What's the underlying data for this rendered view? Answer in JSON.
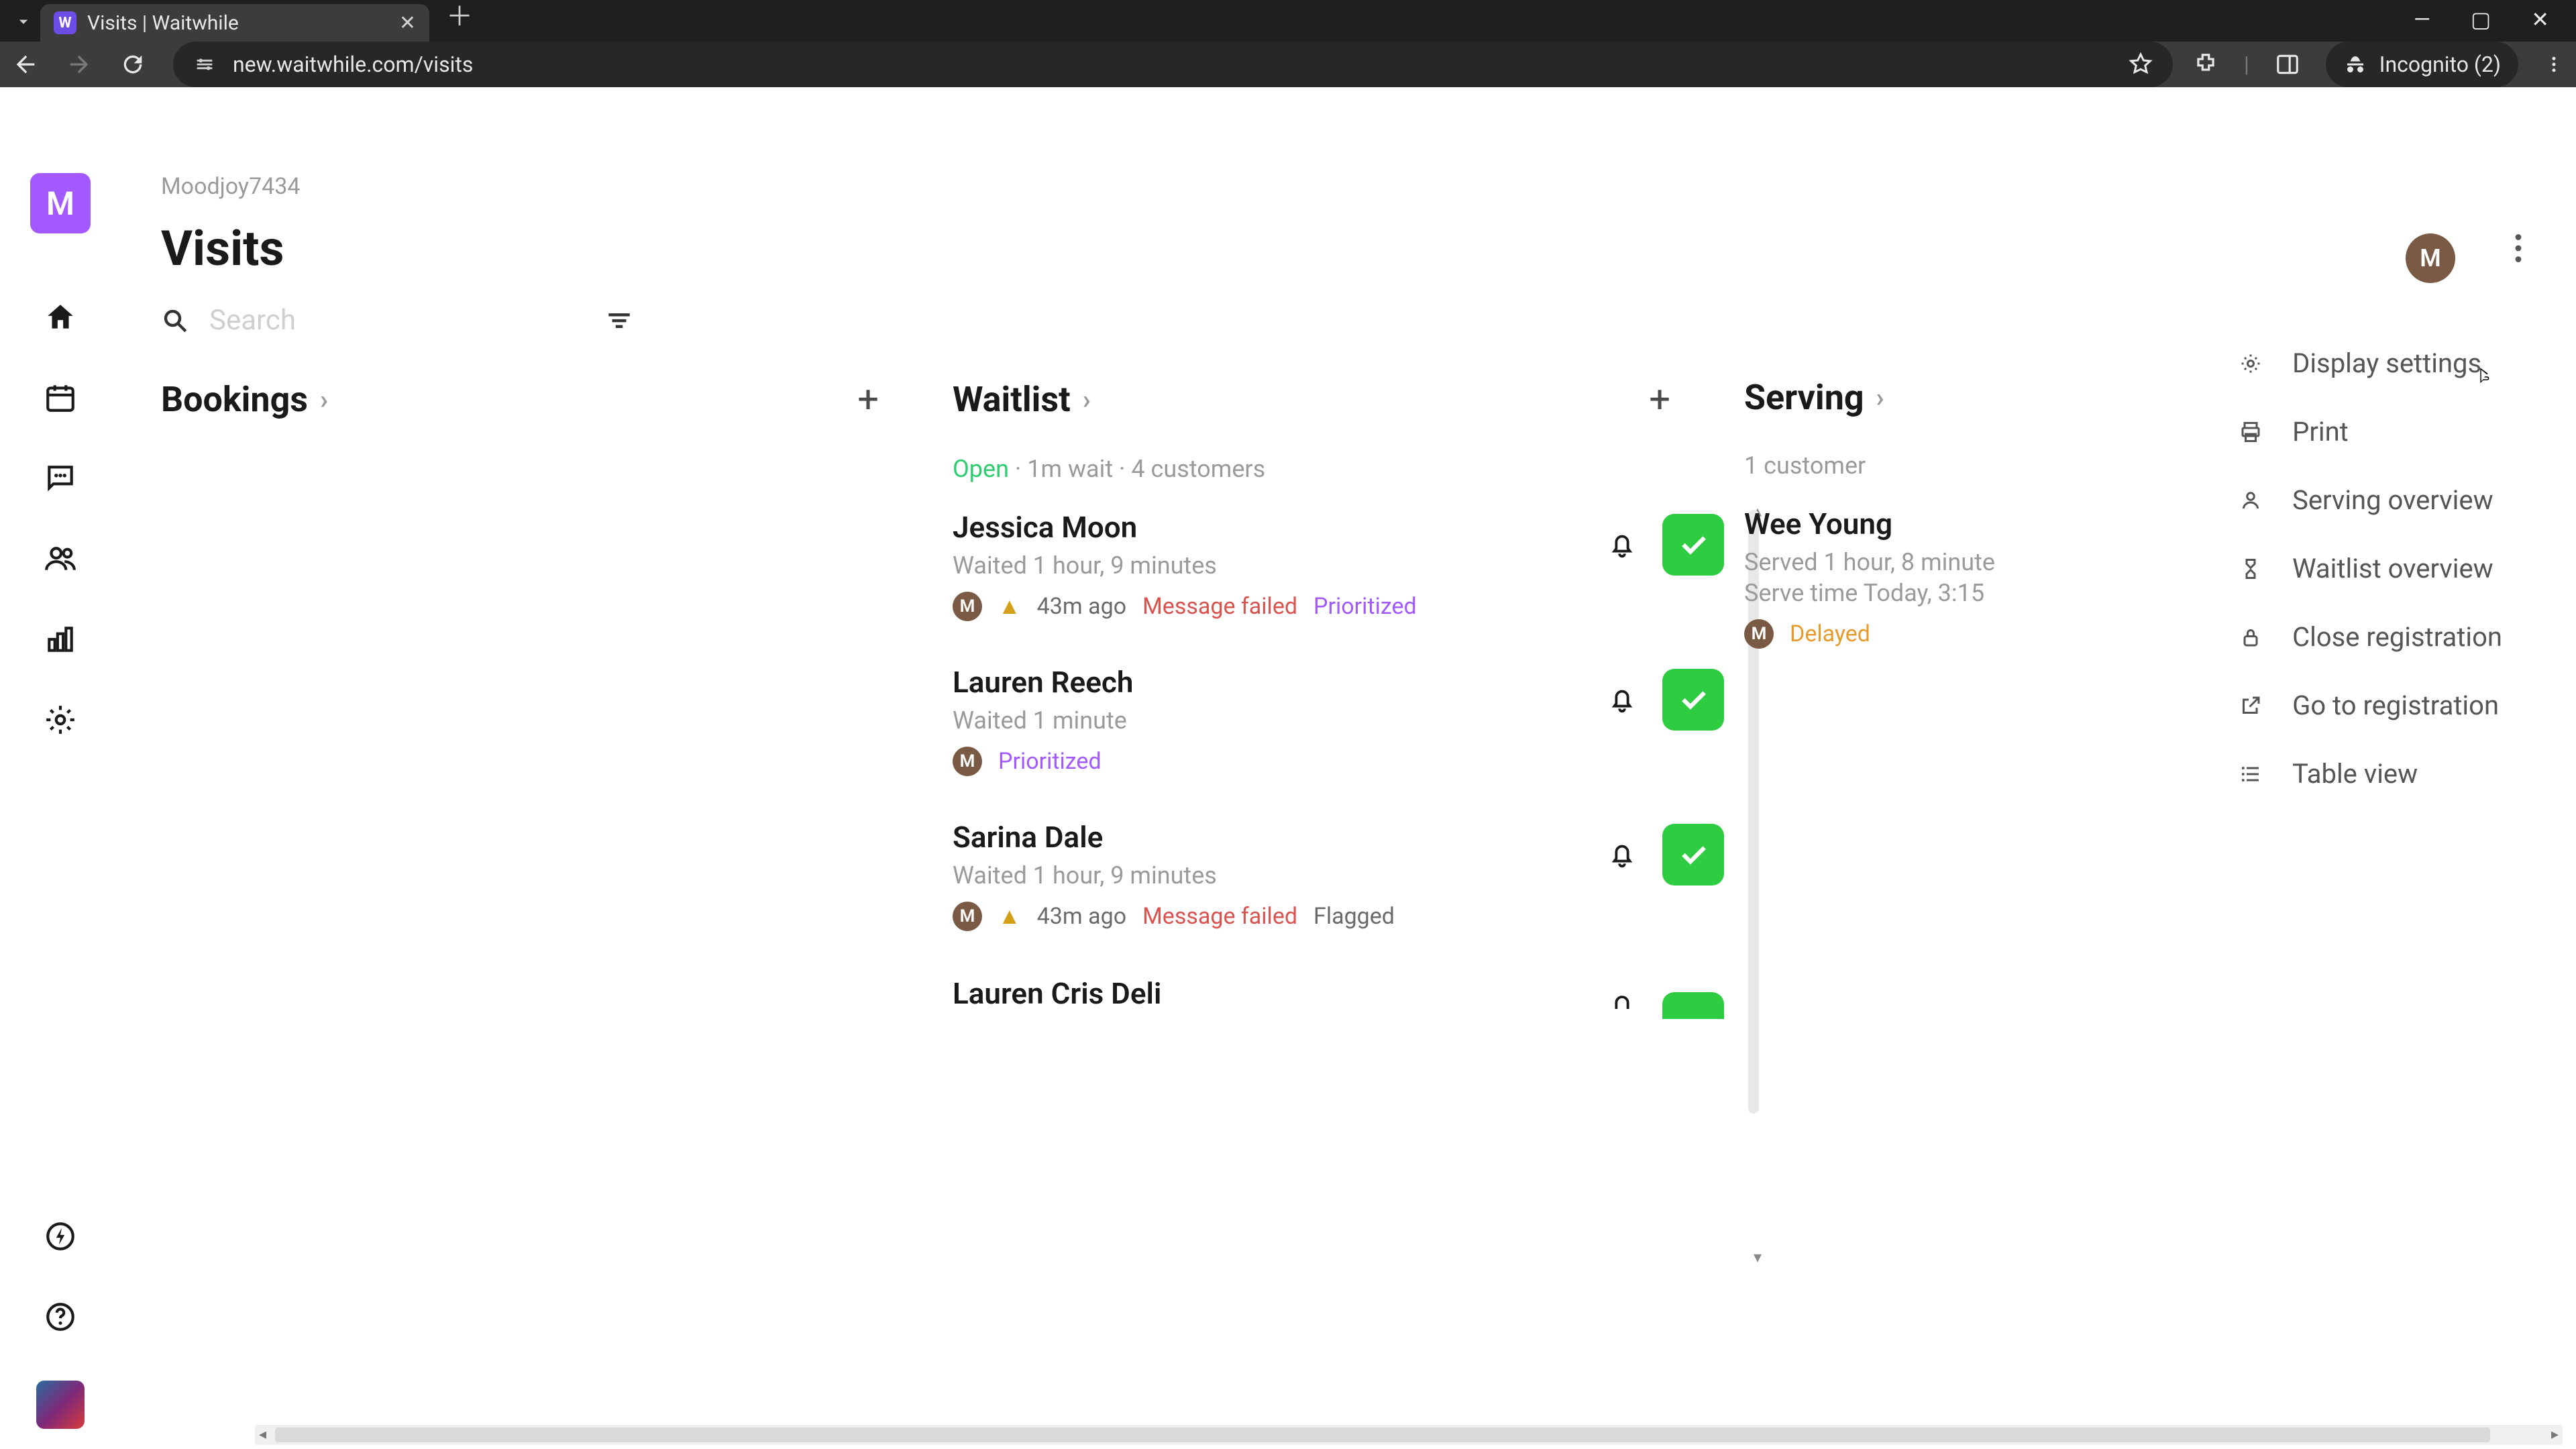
{
  "browser": {
    "tab_title": "Visits | Waitwhile",
    "favicon_letter": "W",
    "url": "new.waitwhile.com/visits",
    "incognito_label": "Incognito (2)"
  },
  "workspace": {
    "brand_letter": "M",
    "name": "Moodjoy7434"
  },
  "page": {
    "title": "Visits",
    "search_placeholder": "Search",
    "avatar_letter": "M"
  },
  "columns": {
    "bookings": {
      "title": "Bookings"
    },
    "waitlist": {
      "title": "Waitlist",
      "status_open": "Open",
      "status_rest": " · 1m wait · 4 customers",
      "items": [
        {
          "name": "Jessica Moon",
          "sub": "Waited 1 hour, 9 minutes",
          "badge": "M",
          "warn": "▲",
          "ago": "43m ago",
          "fail": "Message failed",
          "prio": "Prioritized"
        },
        {
          "name": "Lauren Reech",
          "sub": "Waited 1 minute",
          "badge": "M",
          "prio": "Prioritized"
        },
        {
          "name": "Sarina Dale",
          "sub": "Waited 1 hour, 9 minutes",
          "badge": "M",
          "warn": "▲",
          "ago": "43m ago",
          "fail": "Message failed",
          "flag": "Flagged"
        },
        {
          "name": "Lauren Cris Deli",
          "sub": ""
        }
      ]
    },
    "serving": {
      "title": "Serving",
      "status": "1 customer",
      "items": [
        {
          "name": "Wee Young",
          "sub1": "Served 1 hour, 8 minute",
          "sub2": "Serve time Today, 3:15 ",
          "badge": "M",
          "delayed": "Delayed"
        }
      ]
    }
  },
  "menu": {
    "display_settings": "Display settings",
    "print": "Print",
    "serving_overview": "Serving overview",
    "waitlist_overview": "Waitlist overview",
    "close_registration": "Close registration",
    "go_to_registration": "Go to registration",
    "table_view": "Table view"
  }
}
